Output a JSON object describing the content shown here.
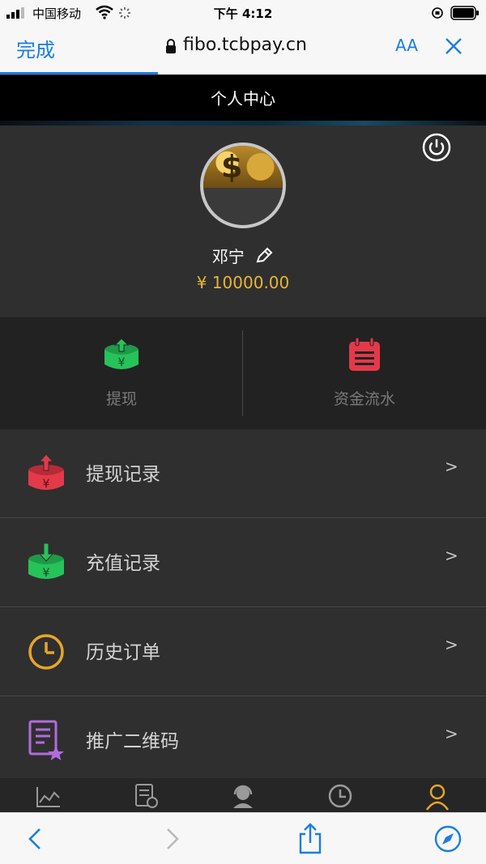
{
  "status_bar": {
    "carrier": "中国移动",
    "time": "下午 4:12"
  },
  "safari": {
    "done_label": "完成",
    "url": "fibo.tcbpay.cn",
    "text_size_label": "AA"
  },
  "page_title": "个人中心",
  "profile": {
    "name": "邓宁",
    "balance": "¥ 10000.00"
  },
  "actions": [
    {
      "label": "提现",
      "icon": "withdraw-icon"
    },
    {
      "label": "资金流水",
      "icon": "ledger-icon"
    }
  ],
  "menu": [
    {
      "label": "提现记录",
      "arrow": ">",
      "icon": "withdraw-record-icon"
    },
    {
      "label": "充值记录",
      "arrow": ">",
      "icon": "recharge-record-icon"
    },
    {
      "label": "历史订单",
      "arrow": ">",
      "icon": "clock-icon"
    },
    {
      "label": "推广二维码",
      "arrow": ">",
      "icon": "qr-document-icon"
    }
  ],
  "tabs": [
    {
      "icon": "chart-icon",
      "label": ""
    },
    {
      "icon": "document-clock-icon",
      "label": ""
    },
    {
      "icon": "support-agent-icon",
      "label": ""
    },
    {
      "icon": "clock-icon",
      "label": ""
    },
    {
      "icon": "user-icon",
      "label": ""
    }
  ],
  "colors": {
    "accent_blue": "#1a7de0",
    "gold": "#e9b535",
    "green": "#27c25a",
    "red": "#e33a4a",
    "orange": "#e6a52a",
    "purple": "#b36be0"
  }
}
